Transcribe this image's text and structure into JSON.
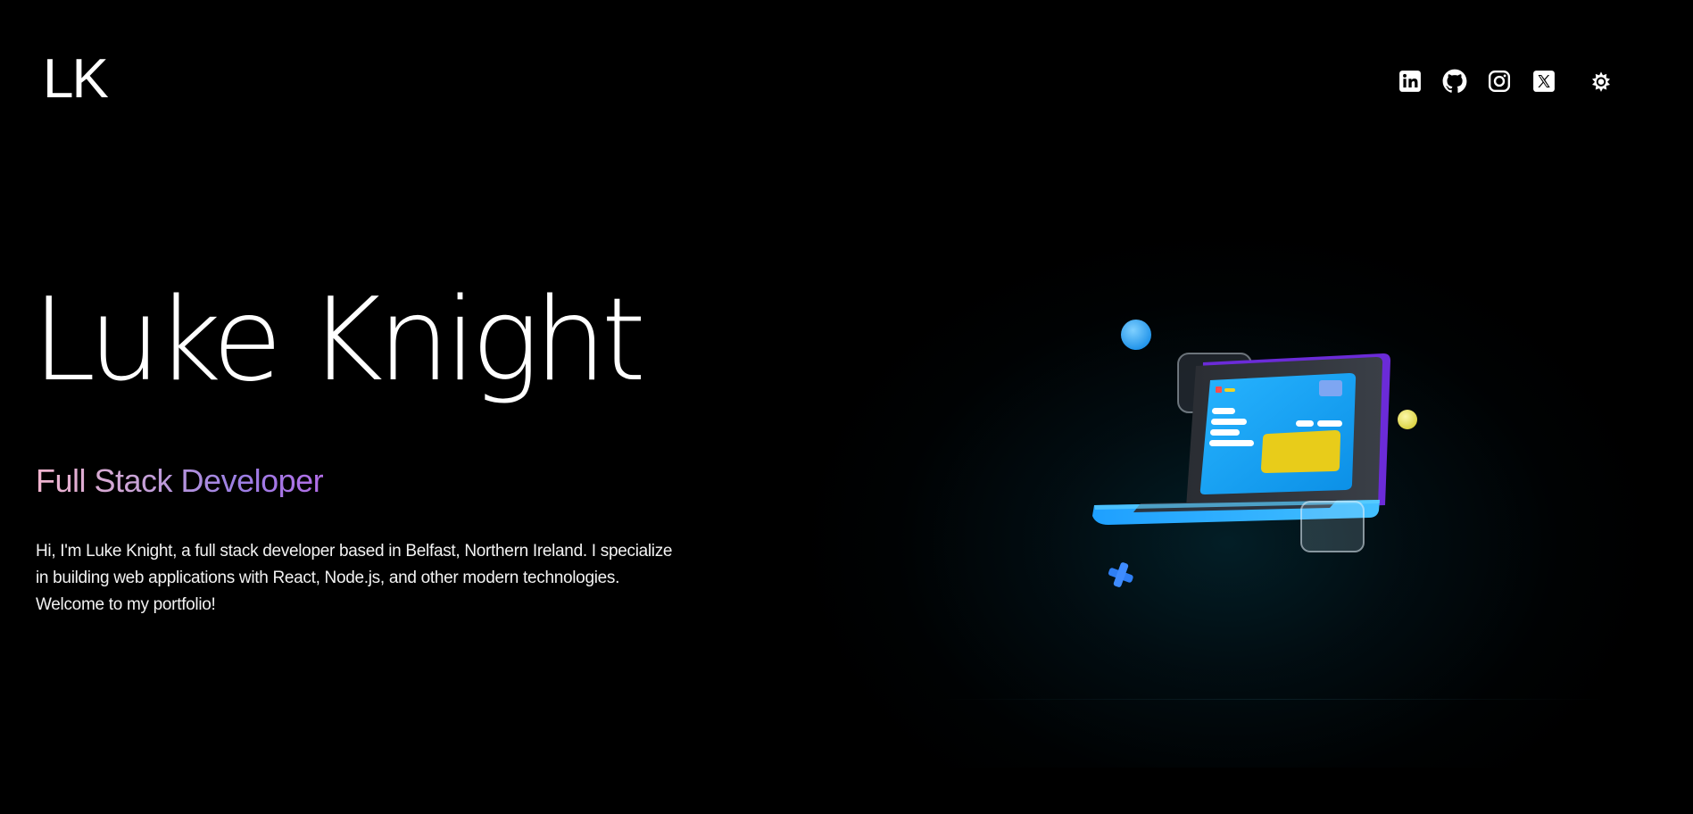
{
  "header": {
    "logo": "LK",
    "social": [
      {
        "icon": "linkedin-icon",
        "label": "LinkedIn"
      },
      {
        "icon": "github-icon",
        "label": "GitHub"
      },
      {
        "icon": "instagram-icon",
        "label": "Instagram"
      },
      {
        "icon": "x-icon",
        "label": "X"
      }
    ],
    "theme_icon": "sun-icon"
  },
  "hero": {
    "name": "Luke Knight",
    "role": "Full Stack Developer",
    "intro": "Hi, I'm Luke Knight, a full stack developer based in Belfast, Northern Ireland. I specialize in building web applications with React, Node.js, and other modern technologies. Welcome to my portfolio!"
  },
  "colors": {
    "background": "#000000",
    "text": "#ffffff",
    "role_gradient_start": "#f2b5cf",
    "role_gradient_end": "#b26de7",
    "laptop_screen": "#0ea5f0",
    "laptop_accent": "#6d28d9",
    "card_yellow": "#e8cc1a"
  }
}
